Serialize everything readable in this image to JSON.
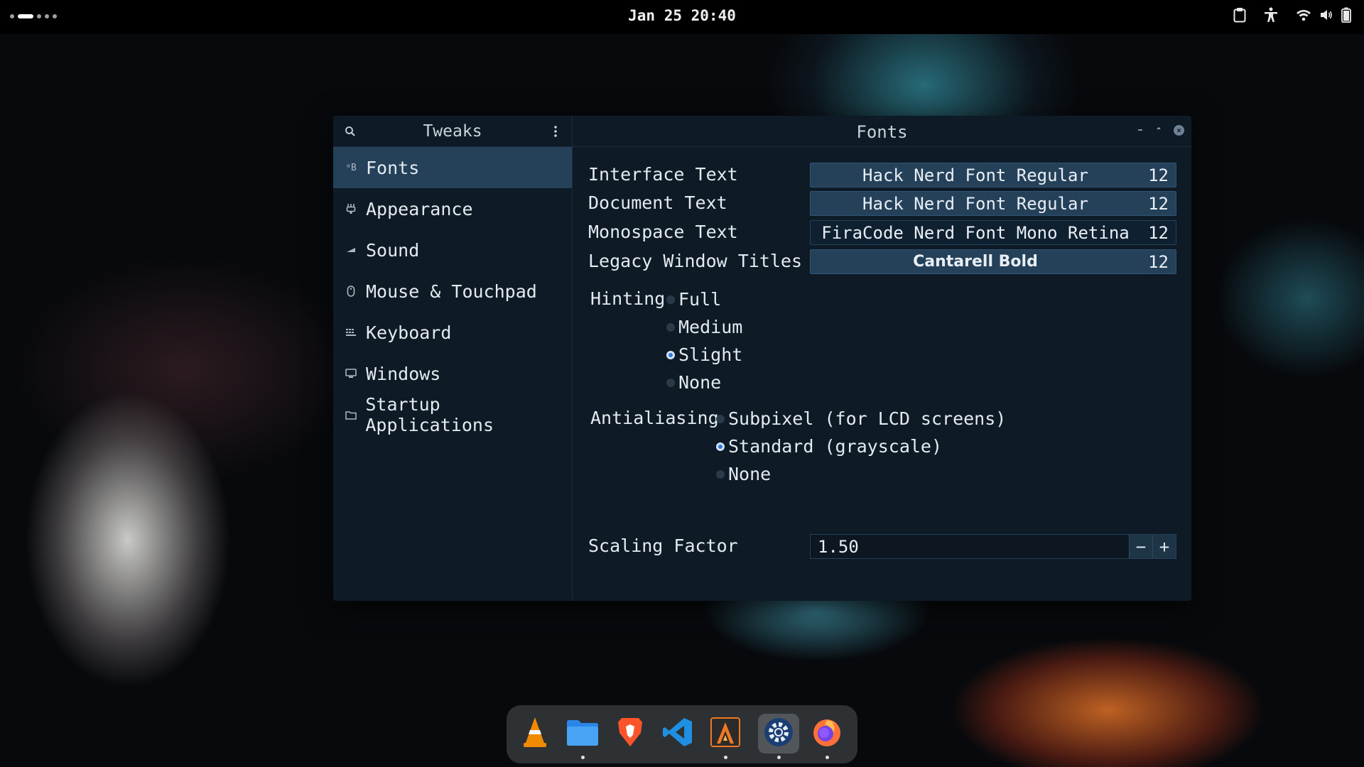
{
  "topbar": {
    "clock": "Jan 25 20:40",
    "icons": [
      "clipboard-icon",
      "accessibility-icon",
      "wifi-icon",
      "volume-icon",
      "battery-icon"
    ]
  },
  "sidebar": {
    "title": "Tweaks",
    "items": [
      {
        "label": "Fonts",
        "icon": "fonts-icon",
        "active": true
      },
      {
        "label": "Appearance",
        "icon": "appearance-icon"
      },
      {
        "label": "Sound",
        "icon": "sound-icon"
      },
      {
        "label": "Mouse & Touchpad",
        "icon": "mouse-icon"
      },
      {
        "label": "Keyboard",
        "icon": "keyboard-icon"
      },
      {
        "label": "Windows",
        "icon": "windows-icon"
      },
      {
        "label": "Startup Applications",
        "icon": "folder-icon"
      }
    ]
  },
  "main": {
    "title": "Fonts",
    "fonts": [
      {
        "label": "Interface Text",
        "font": "Hack Nerd Font Regular",
        "size": "12"
      },
      {
        "label": "Document Text",
        "font": "Hack Nerd Font Regular",
        "size": "12"
      },
      {
        "label": "Monospace Text",
        "font": "FiraCode Nerd Font Mono Retina",
        "size": "12"
      },
      {
        "label": "Legacy Window Titles",
        "font": "Cantarell Bold",
        "size": "12"
      }
    ],
    "hinting": {
      "label": "Hinting",
      "options": [
        "Full",
        "Medium",
        "Slight",
        "None"
      ],
      "selected": "Slight"
    },
    "antialiasing": {
      "label": "Antialiasing",
      "options": [
        "Subpixel (for LCD screens)",
        "Standard (grayscale)",
        "None"
      ],
      "selected": "Standard (grayscale)"
    },
    "scaling": {
      "label": "Scaling Factor",
      "value": "1.50",
      "minus": "−",
      "plus": "+"
    }
  },
  "dock": {
    "apps": [
      {
        "name": "vlc",
        "running": false
      },
      {
        "name": "files",
        "running": true
      },
      {
        "name": "brave",
        "running": false
      },
      {
        "name": "vscode",
        "running": false
      },
      {
        "name": "alacritty",
        "running": true
      },
      {
        "name": "tweaks",
        "running": true,
        "active": true
      },
      {
        "name": "firefox",
        "running": true
      }
    ]
  }
}
